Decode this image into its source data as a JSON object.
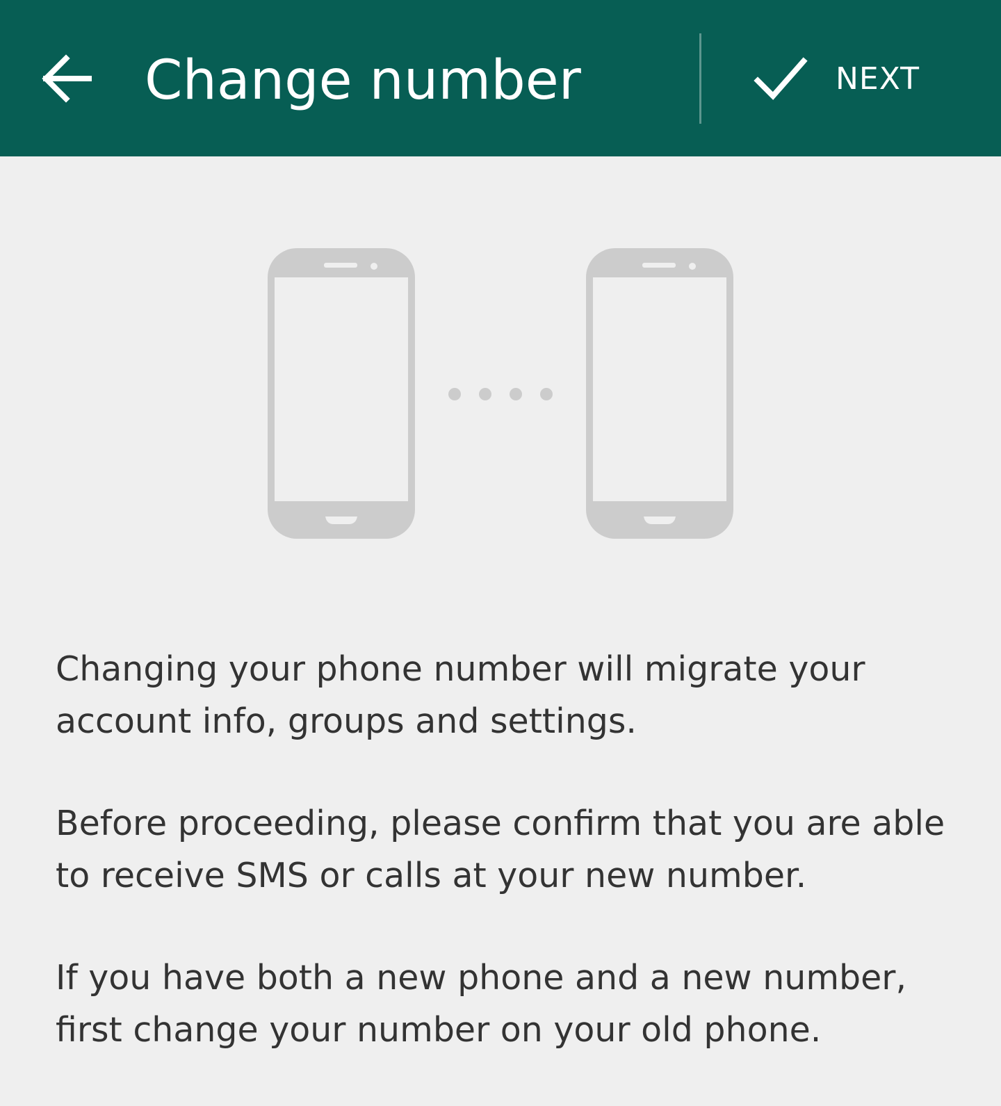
{
  "appbar": {
    "title": "Change number",
    "back_icon": "arrow-left-icon",
    "next_icon": "check-icon",
    "next_label": "NEXT",
    "background_color": "#075e54",
    "text_color": "#ffffff"
  },
  "illustration": {
    "left_phone_icon": "phone-icon",
    "right_phone_icon": "phone-icon",
    "dots_icon": "dots-icon",
    "color": "#cccccc"
  },
  "body": {
    "paragraph_1": "Changing your phone number will migrate your account info, groups and settings.",
    "paragraph_2": "Before proceeding, please confirm that you are able to receive SMS or calls at your new number.",
    "paragraph_3": "If you have both a new phone and a new number, first change your number on your old phone.",
    "background_color": "#efefef",
    "text_color": "#333333"
  }
}
